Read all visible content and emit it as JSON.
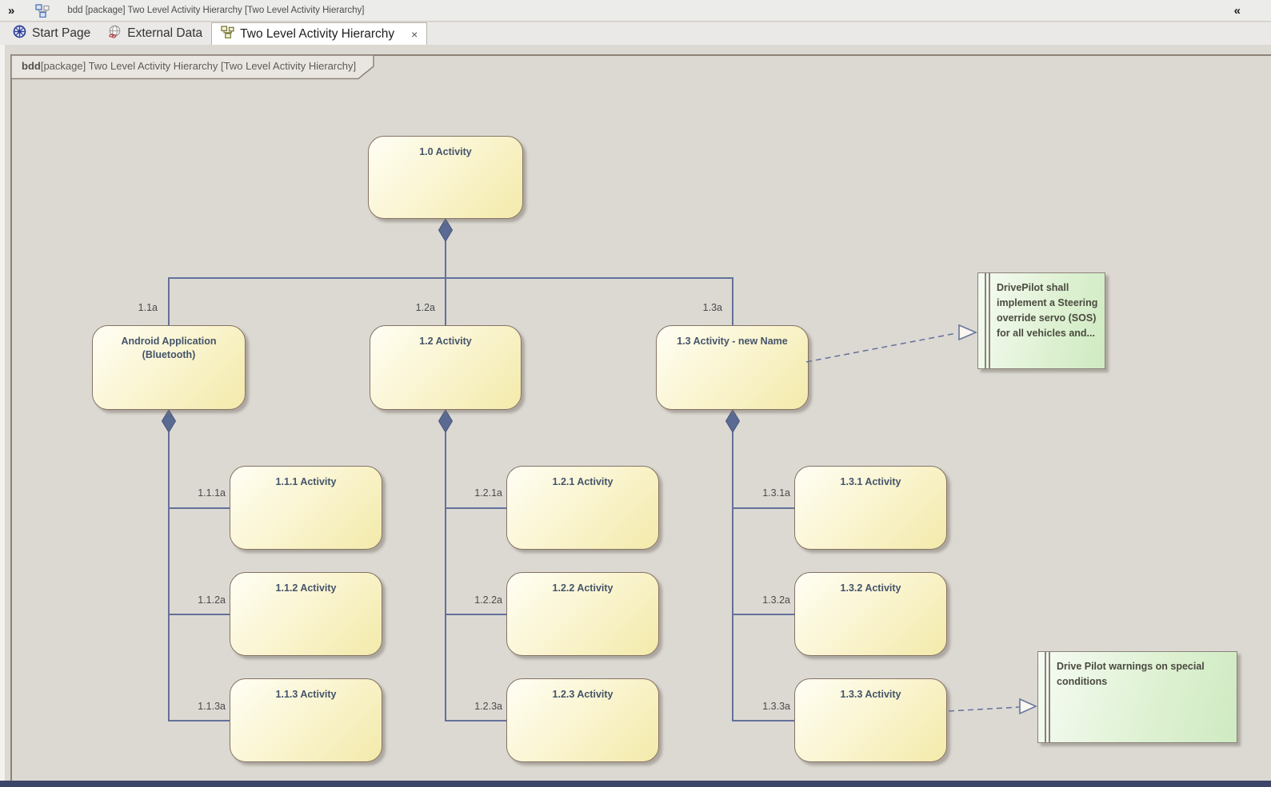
{
  "titlebar": {
    "expand_icon": "»",
    "diagram_icon": "hierarchy-diagram-icon",
    "title": "bdd [package] Two Level Activity Hierarchy [Two Level Activity Hierarchy]",
    "collapse_icon": "«"
  },
  "tabs": [
    {
      "label": "Start Page",
      "icon": "start-page-wheel-icon",
      "active": false
    },
    {
      "label": "External Data",
      "icon": "globe-link-icon",
      "active": false
    },
    {
      "label": "Two Level Activity Hierarchy",
      "icon": "hierarchy-diagram-icon",
      "active": true,
      "close_icon": "×"
    }
  ],
  "diagram": {
    "frame": {
      "keyword": "bdd",
      "label": "[package] Two Level Activity Hierarchy [Two Level Activity Hierarchy]"
    },
    "nodes": [
      "1.0 Activity",
      "Android Application (Bluetooth)",
      "1.2 Activity",
      "1.3 Activity - new Name",
      "1.1.1 Activity",
      "1.1.2 Activity",
      "1.1.3 Activity",
      "1.2.1 Activity",
      "1.2.2 Activity",
      "1.2.3 Activity",
      "1.3.1 Activity",
      "1.3.2 Activity",
      "1.3.3 Activity"
    ],
    "edge_labels": [
      "1.1a",
      "1.2a",
      "1.3a",
      "1.1.1a",
      "1.1.2a",
      "1.1.3a",
      "1.2.1a",
      "1.2.2a",
      "1.2.3a",
      "1.3.1a",
      "1.3.2a",
      "1.3.3a"
    ],
    "edges": [
      {
        "from": "1.0 Activity",
        "to": "Android Application (Bluetooth)",
        "label": "1.1a",
        "type": "composition"
      },
      {
        "from": "1.0 Activity",
        "to": "1.2 Activity",
        "label": "1.2a",
        "type": "composition"
      },
      {
        "from": "1.0 Activity",
        "to": "1.3 Activity - new Name",
        "label": "1.3a",
        "type": "composition"
      },
      {
        "from": "Android Application (Bluetooth)",
        "to": "1.1.1 Activity",
        "label": "1.1.1a",
        "type": "composition"
      },
      {
        "from": "Android Application (Bluetooth)",
        "to": "1.1.2 Activity",
        "label": "1.1.2a",
        "type": "composition"
      },
      {
        "from": "Android Application (Bluetooth)",
        "to": "1.1.3 Activity",
        "label": "1.1.3a",
        "type": "composition"
      },
      {
        "from": "1.2 Activity",
        "to": "1.2.1 Activity",
        "label": "1.2.1a",
        "type": "composition"
      },
      {
        "from": "1.2 Activity",
        "to": "1.2.2 Activity",
        "label": "1.2.2a",
        "type": "composition"
      },
      {
        "from": "1.2 Activity",
        "to": "1.2.3 Activity",
        "label": "1.2.3a",
        "type": "composition"
      },
      {
        "from": "1.3 Activity - new Name",
        "to": "1.3.1 Activity",
        "label": "1.3.1a",
        "type": "composition"
      },
      {
        "from": "1.3 Activity - new Name",
        "to": "1.3.2 Activity",
        "label": "1.3.2a",
        "type": "composition"
      },
      {
        "from": "1.3 Activity - new Name",
        "to": "DrivePilot note",
        "type": "dashed-realization"
      },
      {
        "from": "1.3.3 Activity",
        "to": "Drive Pilot warnings note",
        "type": "dashed-realization"
      }
    ],
    "notes": [
      {
        "text": "DrivePilot shall implement a Steering override servo (SOS) for all vehicles and..."
      },
      {
        "text": "Drive Pilot warnings on special conditions"
      }
    ],
    "colors": {
      "canvas_bg": "#dcd9d3",
      "node_fill_light": "#fffef4",
      "node_fill_dark": "#f3eaaa",
      "node_border": "#857265",
      "node_text": "#44546a",
      "connector": "#63719a",
      "diamond": "#5a6a92",
      "note_fill_light": "#f6fbf3",
      "note_fill_dark": "#cfeac2",
      "note_border": "#8a8178",
      "note_text": "#4b4a40",
      "bottom_strip": "#3d4669"
    }
  }
}
